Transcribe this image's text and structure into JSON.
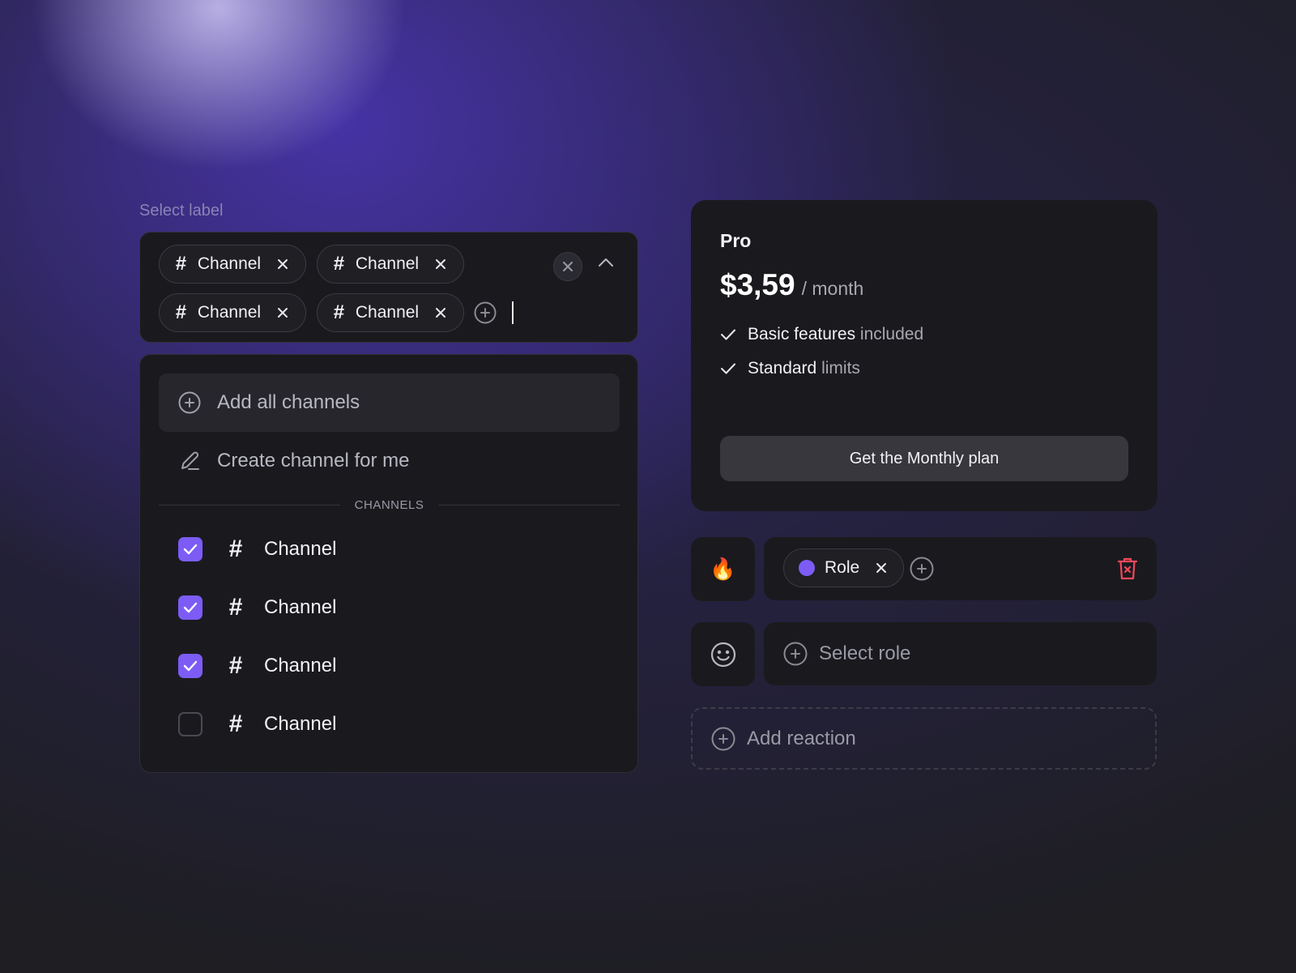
{
  "colors": {
    "accent": "#7c5cf5",
    "danger": "#f2495c",
    "card": "#1a1a1e",
    "button": "#37373d"
  },
  "select": {
    "label": "Select label",
    "chips": [
      {
        "hash": "#",
        "label": "Channel"
      },
      {
        "hash": "#",
        "label": "Channel"
      },
      {
        "hash": "#",
        "label": "Channel"
      },
      {
        "hash": "#",
        "label": "Channel"
      }
    ],
    "icons": [
      "hash-icon",
      "close-icon",
      "clear-icon",
      "chevron-up-icon",
      "plus-circle-icon"
    ]
  },
  "dropdown": {
    "add_all": "Add all channels",
    "create": "Create channel for me",
    "section": "CHANNELS",
    "channels": [
      {
        "hash": "#",
        "label": "Channel",
        "checked": true
      },
      {
        "hash": "#",
        "label": "Channel",
        "checked": true
      },
      {
        "hash": "#",
        "label": "Channel",
        "checked": true
      },
      {
        "hash": "#",
        "label": "Channel",
        "checked": false
      }
    ]
  },
  "pricing": {
    "plan": "Pro",
    "price": "$3,59",
    "period": "/ month",
    "features": [
      {
        "strong": "Basic features",
        "muted": "included"
      },
      {
        "strong": "Standard limits",
        "muted": "limits"
      }
    ],
    "cta": "Get the Monthly plan"
  },
  "roles": {
    "row1": {
      "emoji": "🔥",
      "chip": "Role",
      "chip_color": "#7c5cf5"
    },
    "row2": {
      "placeholder": "Select role",
      "icon": "smiley-icon"
    },
    "add_reaction": "Add reaction"
  }
}
